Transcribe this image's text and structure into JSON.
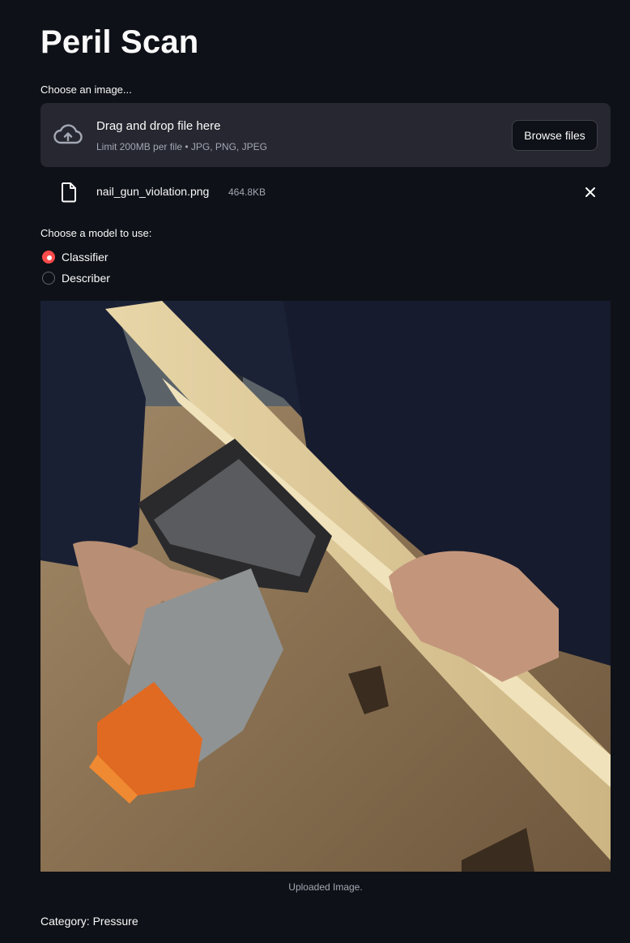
{
  "app": {
    "title": "Peril Scan"
  },
  "uploader": {
    "label": "Choose an image...",
    "drop_title": "Drag and drop file here",
    "drop_subtitle": "Limit 200MB per file • JPG, PNG, JPEG",
    "browse_label": "Browse files",
    "file": {
      "name": "nail_gun_violation.png",
      "size": "464.8KB"
    }
  },
  "model_select": {
    "label": "Choose a model to use:",
    "options": [
      {
        "label": "Classifier",
        "selected": true
      },
      {
        "label": "Describer",
        "selected": false
      }
    ]
  },
  "image": {
    "caption": "Uploaded Image."
  },
  "result": {
    "text": "Category: Pressure"
  },
  "colors": {
    "background": "#0e1117",
    "surface": "#262730",
    "accent": "#ff4b4b",
    "muted_text": "#a3a8b4"
  },
  "icons": {
    "upload": "cloud-upload-icon",
    "file": "file-icon",
    "close": "close-icon"
  }
}
